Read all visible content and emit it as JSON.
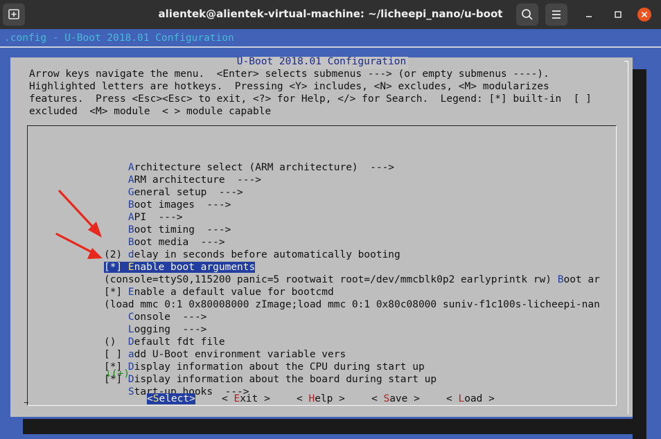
{
  "window": {
    "title": "alientek@alientek-virtual-machine: ~/licheepi_nano/u-boot",
    "new_tab_icon": "new-tab-icon",
    "search_icon": "search-icon",
    "menu_icon": "hamburger-menu-icon"
  },
  "terminal": {
    "header_text": ".config - U-Boot 2018.01 Configuration",
    "dialog_title": " U-Boot 2018.01 Configuration ",
    "help_lines": [
      "Arrow keys navigate the menu.  <Enter> selects submenus ---> (or empty submenus ----).",
      "Highlighted letters are hotkeys.  Pressing <Y> includes, <N> excludes, <M> modularizes",
      "features.  Press <Esc><Esc> to exit, <?> for Help, </> for Search.  Legend: [*] built-in  [ ]",
      "excluded  <M> module  < > module capable"
    ],
    "menu_items": [
      {
        "prefix": "    ",
        "hot": "A",
        "rest": "rchitecture select (ARM architecture)  --->"
      },
      {
        "prefix": "    ",
        "hot": "A",
        "rest": "RM architecture  --->"
      },
      {
        "prefix": "    ",
        "hot": "G",
        "rest": "eneral setup  --->"
      },
      {
        "prefix": "    ",
        "hot": "B",
        "rest": "oot images  --->"
      },
      {
        "prefix": "    ",
        "hot": "A",
        "rest": "PI  --->"
      },
      {
        "prefix": "    ",
        "hot": "B",
        "rest": "oot timing  --->"
      },
      {
        "prefix": "    ",
        "hot": "B",
        "rest": "oot media  --->"
      },
      {
        "prefix": "(2) ",
        "hot": "d",
        "rest": "elay in seconds before automatically booting"
      },
      {
        "prefix": "[*] ",
        "hot": "E",
        "rest": "nable boot arguments"
      },
      {
        "prefix": "(console=ttyS0,115200 panic=5 rootwait root=/dev/mmcblk0p2 earlyprintk rw) ",
        "hot": "B",
        "rest": "oot ar"
      },
      {
        "prefix": "[*] ",
        "hot": "E",
        "rest": "nable a default value for bootcmd"
      },
      {
        "prefix": "(",
        "hot": "",
        "rest": "load mmc 0:1 0x80008000 zImage;load mmc 0:1 0x80c08000 suniv-f1c100s-licheepi-nan"
      },
      {
        "prefix": "    ",
        "hot": "C",
        "rest": "onsole  --->"
      },
      {
        "prefix": "    ",
        "hot": "L",
        "rest": "ogging  --->"
      },
      {
        "prefix": "()  ",
        "hot": "D",
        "rest": "efault fdt file"
      },
      {
        "prefix": "[ ] ",
        "hot": "a",
        "rest": "dd U-Boot environment variable vers"
      },
      {
        "prefix": "[*] ",
        "hot": "D",
        "rest": "isplay information about the CPU during start up"
      },
      {
        "prefix": "[*] ",
        "hot": "D",
        "rest": "isplay information about the board during start up"
      },
      {
        "prefix": "    ",
        "hot": "S",
        "rest": "tart-up hooks  --->"
      }
    ],
    "more_indicator": "↓(+)",
    "buttons": [
      {
        "left": "<",
        "hot": "S",
        "rest": "elect",
        "right": ">"
      },
      {
        "left": "< ",
        "hot": "E",
        "rest": "xit",
        "right": " >"
      },
      {
        "left": "< ",
        "hot": "H",
        "rest": "elp",
        "right": " >"
      },
      {
        "left": "< ",
        "hot": "S",
        "rest": "ave",
        "right": " >"
      },
      {
        "left": "< ",
        "hot": "L",
        "rest": "oad",
        "right": " >"
      }
    ]
  },
  "colors": {
    "terminal_bg": "#4262b8",
    "dialog_bg": "#bebebe",
    "highlight_bg": "#213ea0",
    "hotkey": "#213ea0",
    "selected_hotkey": "#f7e36a",
    "button_hotkey": "#b31e1e",
    "arrow_annotation": "#e8281c"
  }
}
